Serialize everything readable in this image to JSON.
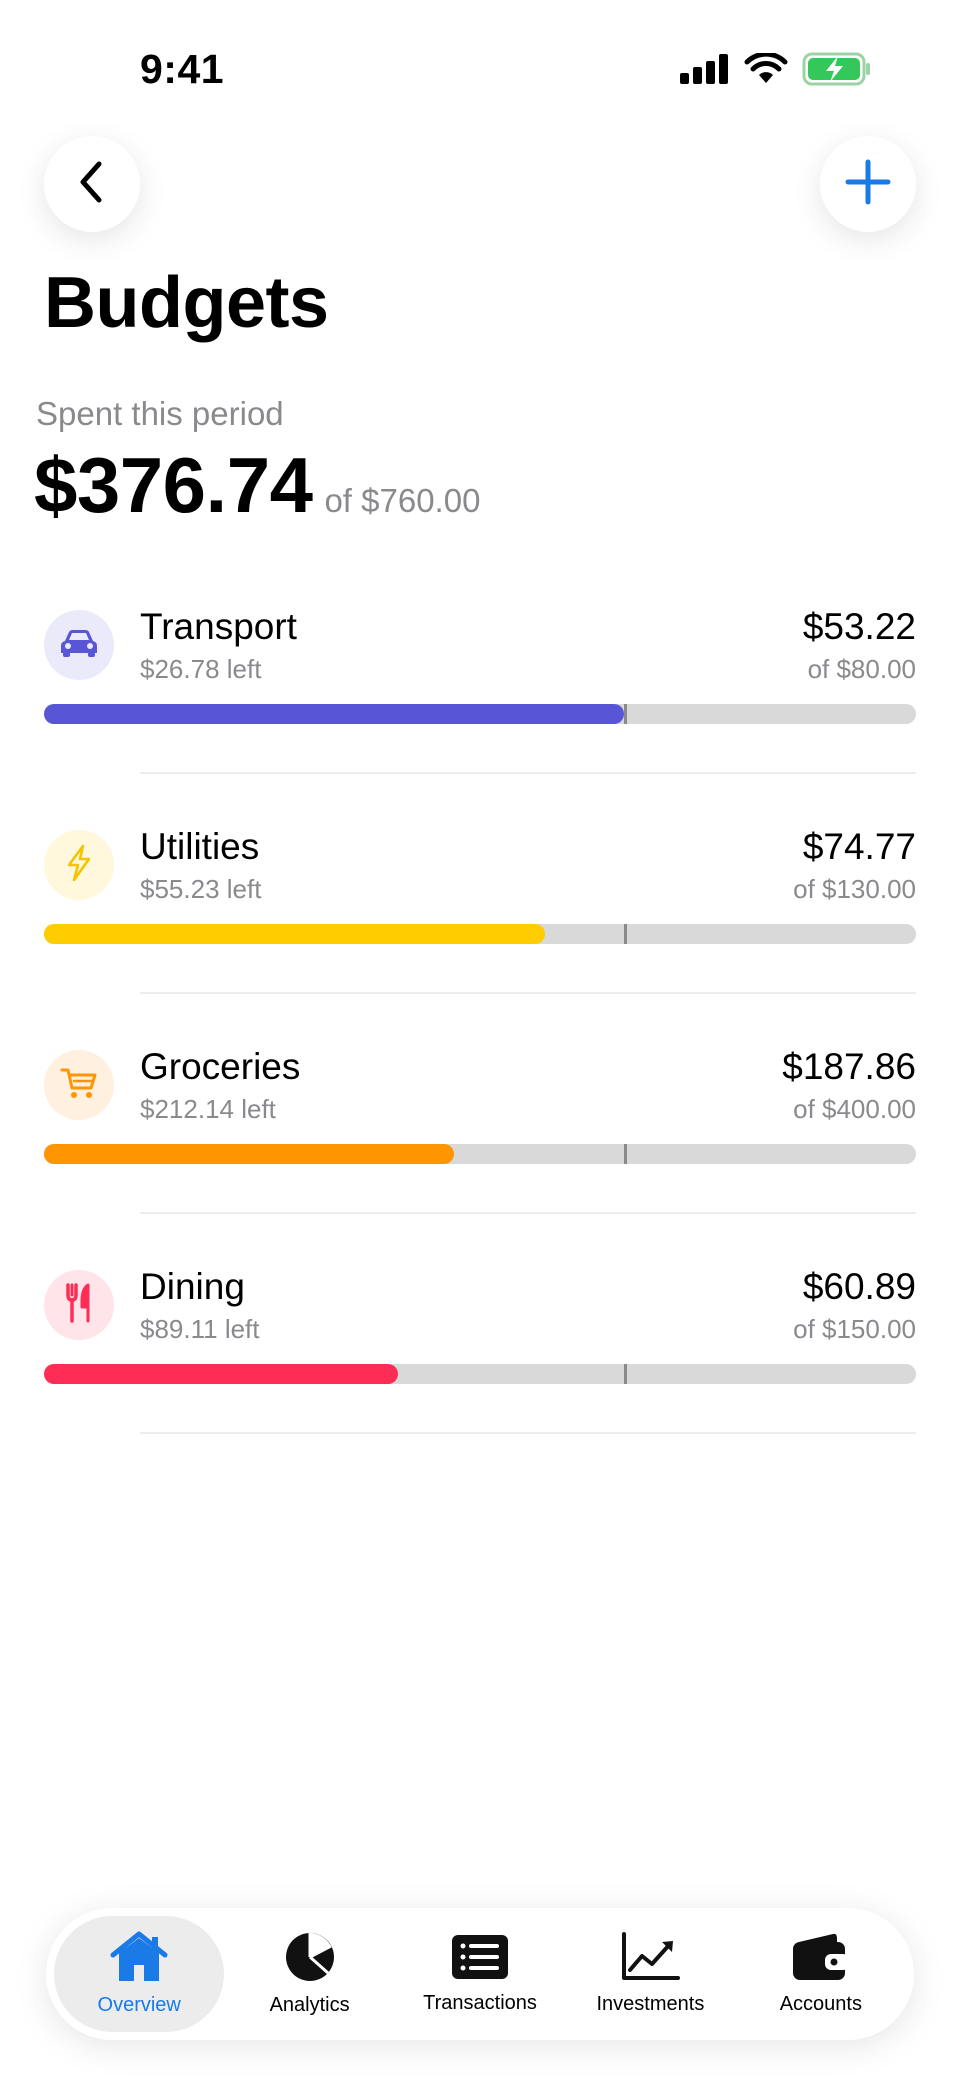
{
  "status_bar": {
    "time": "9:41",
    "icons": [
      "signal-icon",
      "wifi-icon",
      "battery-charging-icon"
    ]
  },
  "nav": {
    "back_icon": "chevron-left-icon",
    "add_icon": "plus-icon"
  },
  "page": {
    "title": "Budgets"
  },
  "summary": {
    "label": "Spent this period",
    "spent": "$376.74",
    "total": "of $760.00"
  },
  "colors": {
    "accent": "#1a7ae6",
    "track": "#d9d9d9",
    "muted": "#8a8a8e"
  },
  "budgets": [
    {
      "name": "Transport",
      "left": "$26.78 left",
      "spent": "$53.22",
      "limit": "of $80.00",
      "progress": 0.665,
      "color": "#5856d6",
      "icon_bg": "#ebeafb",
      "icon": "car-icon"
    },
    {
      "name": "Utilities",
      "left": "$55.23 left",
      "spent": "$74.77",
      "limit": "of $130.00",
      "progress": 0.575,
      "color": "#ffcc00",
      "icon_bg": "#fff8dd",
      "icon": "bolt-icon"
    },
    {
      "name": "Groceries",
      "left": "$212.14 left",
      "spent": "$187.86",
      "limit": "of $400.00",
      "progress": 0.47,
      "color": "#ff9500",
      "icon_bg": "#fff0df",
      "icon": "cart-icon"
    },
    {
      "name": "Dining",
      "left": "$89.11 left",
      "spent": "$60.89",
      "limit": "of $150.00",
      "progress": 0.406,
      "color": "#ff2d55",
      "icon_bg": "#ffe4ea",
      "icon": "fork-knife-icon"
    }
  ],
  "period_marker": 0.665,
  "tabs": [
    {
      "label": "Overview",
      "icon": "home-icon",
      "active": true
    },
    {
      "label": "Analytics",
      "icon": "pie-chart-icon",
      "active": false
    },
    {
      "label": "Transactions",
      "icon": "list-icon",
      "active": false
    },
    {
      "label": "Investments",
      "icon": "trend-chart-icon",
      "active": false
    },
    {
      "label": "Accounts",
      "icon": "wallet-icon",
      "active": false
    }
  ]
}
